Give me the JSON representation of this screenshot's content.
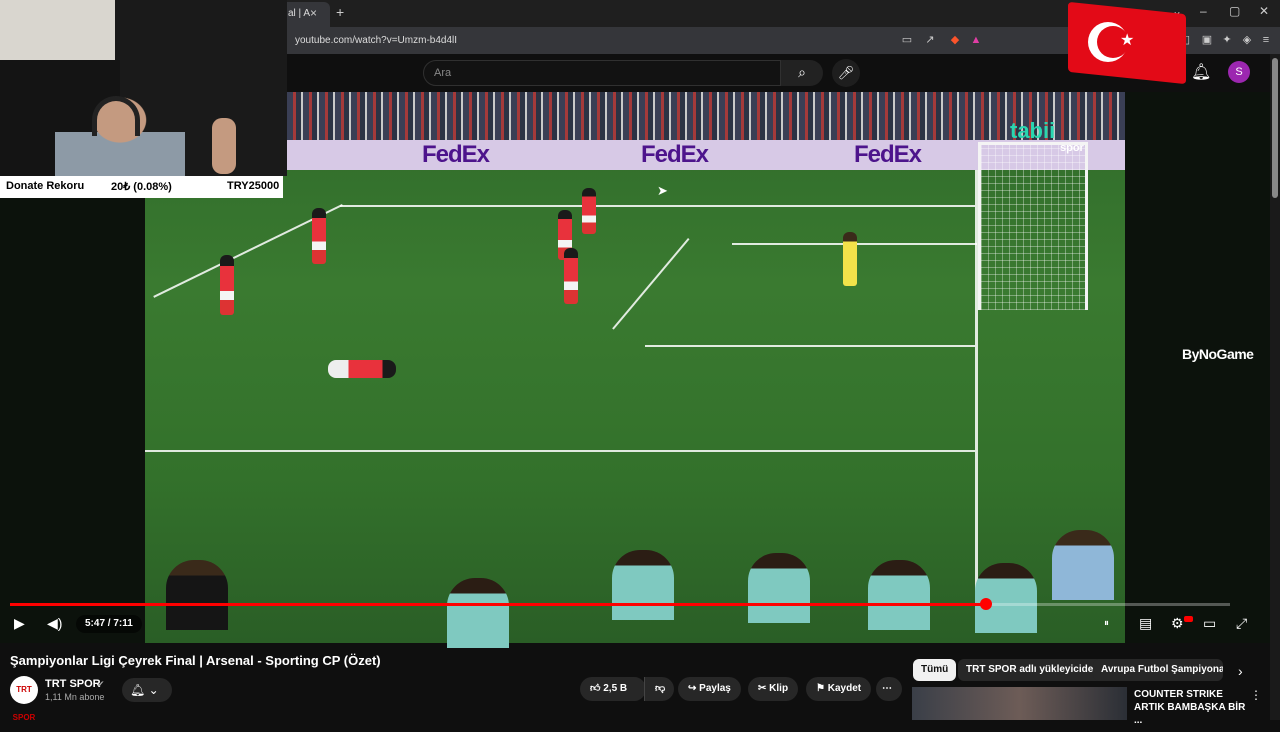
{
  "browser": {
    "tab_title": "al | A",
    "tab_close": "×",
    "new_tab": "+",
    "url": "youtube.com/watch?v=Umzm-b4d4lI",
    "window_controls": [
      "⌄",
      "–",
      "▢",
      "✕"
    ]
  },
  "youtube": {
    "search_placeholder": "Ara",
    "avatar_letter": "S"
  },
  "stream_overlay": {
    "donate_label": "Donate Rekoru",
    "donate_amount": "20₺ (0.08%)",
    "donate_goal": "TRY25000",
    "brand": "ByNoGame"
  },
  "video_scene": {
    "sponsor_boards": [
      "FedEx",
      "FedEx",
      "FedEx"
    ],
    "broadcaster": "tabii",
    "broadcaster_sub": "spor"
  },
  "player": {
    "time": "5:47 / 7:11",
    "progress": 0.8
  },
  "video_info": {
    "title": "Şampiyonlar Ligi Çeyrek Final | Arsenal - Sporting CP (Özet)",
    "channel_name": "TRT SPOR",
    "channel_logo": "TRT SPOR",
    "subscribers": "1,11 Mn abone",
    "likes": "2,5 B",
    "share": "Paylaş",
    "clip": "Klip",
    "save": "Kaydet"
  },
  "chips": [
    "Tümü",
    "TRT SPOR adlı yükleyiciden",
    "Avrupa Futbol Şampiyonası"
  ],
  "recommendation": {
    "title": "COUNTER STRIKE ARTIK BAMBAŞKA BİR ..."
  },
  "colors": {
    "progress": "#ff0000",
    "accent_avatar": "#9c27b0",
    "flag_red": "#e30a17"
  }
}
